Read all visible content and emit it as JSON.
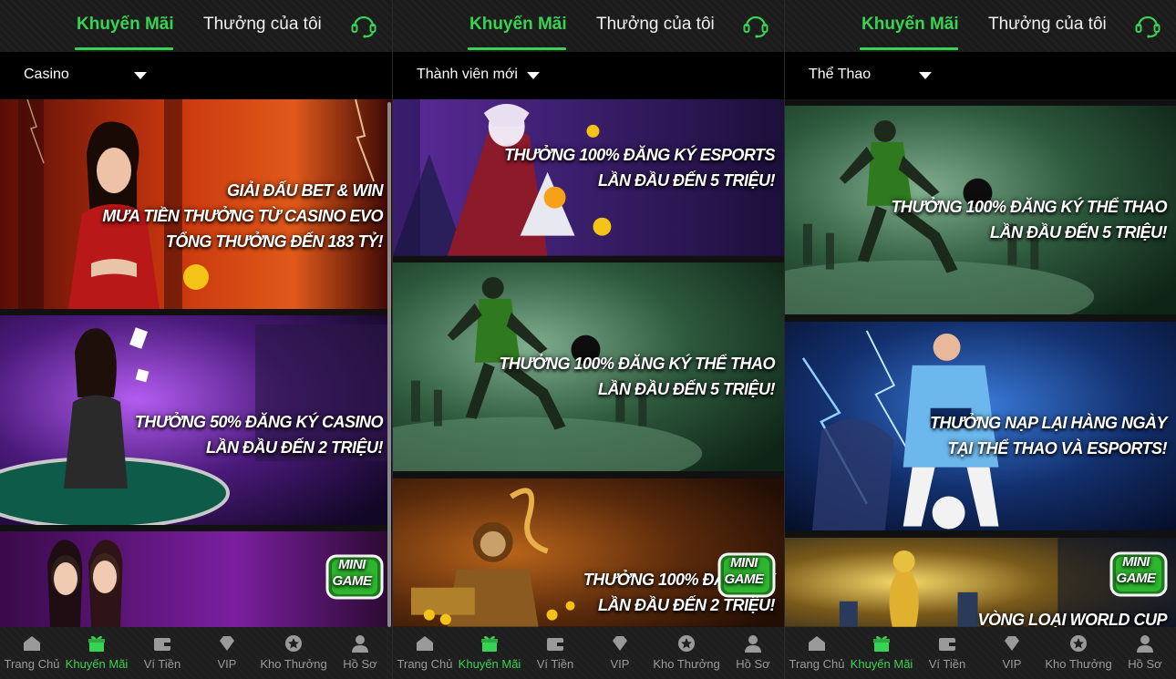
{
  "colors": {
    "accent": "#39d353",
    "background": "#101010",
    "nav_inactive": "#9a9a9a"
  },
  "tabs": {
    "promotions": "Khuyến Mãi",
    "my_rewards": "Thưởng của tôi",
    "support_icon": "headset-icon"
  },
  "nav": {
    "home": "Trang Chủ",
    "promotions": "Khuyến Mãi",
    "wallet": "Ví Tiền",
    "vip": "VIP",
    "reward_store": "Kho Thưởng",
    "profile": "Hồ Sơ",
    "active": "promotions"
  },
  "panels": [
    {
      "filter": "Casino",
      "banners": [
        {
          "lines": [
            "GIẢI ĐẤU BET & WIN",
            "MƯA TIỀN THƯỞNG TỪ CASINO EVO",
            "TỔNG THƯỞNG ĐẾN 183 TỶ!"
          ]
        },
        {
          "lines": [
            "THƯỞNG 50% ĐĂNG KÝ CASINO",
            "LẦN ĐẦU ĐẾN 2 TRIỆU!"
          ]
        },
        {
          "lines": [
            "MINI GAME"
          ]
        }
      ]
    },
    {
      "filter": "Thành viên mới",
      "banners": [
        {
          "lines": [
            "THƯỞNG 100% ĐĂNG KÝ ESPORTS",
            "LẦN ĐẦU ĐẾN 5 TRIỆU!"
          ]
        },
        {
          "lines": [
            "THƯỞNG 100% ĐĂNG KÝ THỂ THAO",
            "LẦN ĐẦU ĐẾN 5 TRIỆU!"
          ]
        },
        {
          "lines": [
            "THƯỞNG 100% ĐĂNG KÝ",
            "LẦN ĐẦU ĐẾN 2 TRIỆU!"
          ],
          "badge": "MINI GAME"
        }
      ]
    },
    {
      "filter": "Thể Thao",
      "banners": [
        {
          "lines": [
            "THƯỞNG 100% ĐĂNG KÝ THỂ THAO",
            "LẦN ĐẦU ĐẾN 5 TRIỆU!"
          ]
        },
        {
          "lines": [
            "THƯỞNG NẠP LẠI HÀNG NGÀY",
            "TẠI THỂ THAO VÀ ESPORTS!"
          ]
        },
        {
          "lines": [
            "VÒNG LOẠI WORLD CUP"
          ],
          "badge": "MINI GAME"
        }
      ]
    }
  ]
}
